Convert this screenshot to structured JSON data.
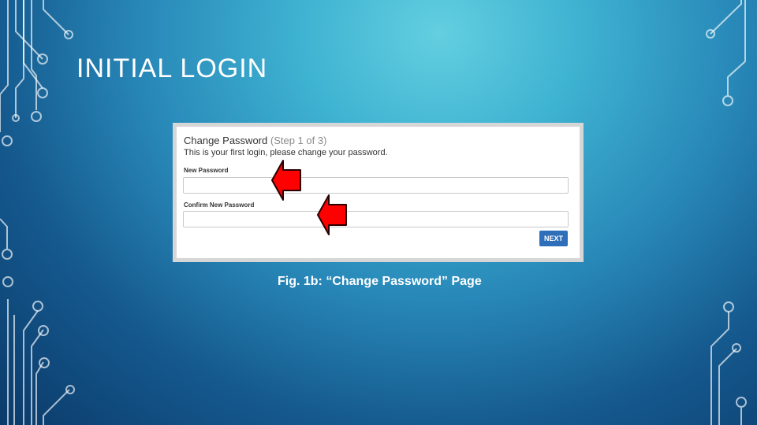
{
  "slide": {
    "title": "INITIAL LOGIN",
    "caption": "Fig. 1b: “Change Password” Page"
  },
  "form": {
    "heading": "Change Password",
    "step": "(Step 1 of 3)",
    "subtitle": "This is your first login, please change your password.",
    "new_password_label": "New Password",
    "new_password_value": "",
    "confirm_password_label": "Confirm New Password",
    "confirm_password_value": "",
    "next_label": "NEXT"
  },
  "colors": {
    "accent_button": "#2f6fba",
    "arrow": "#ff0000",
    "circuit": "#ffffff"
  },
  "icons": {
    "arrows": "arrow-right-icon",
    "decor": "circuit-board-decoration"
  }
}
